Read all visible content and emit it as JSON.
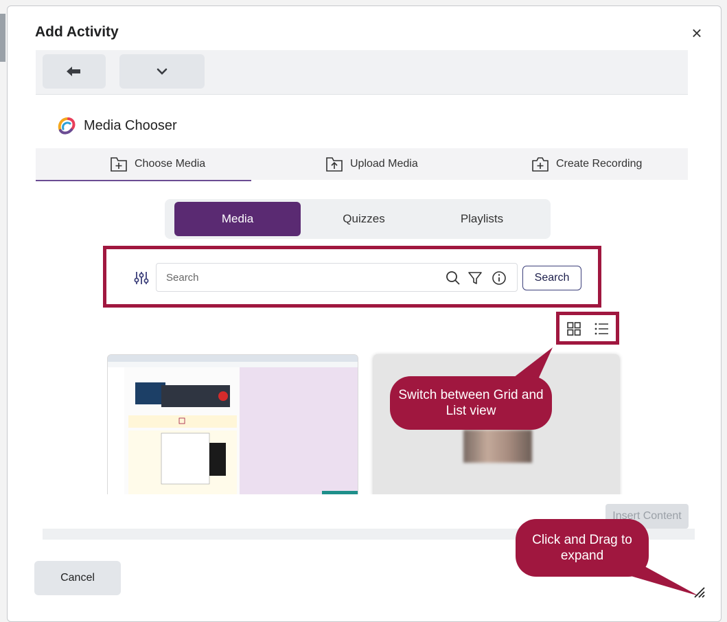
{
  "dialog": {
    "title": "Add Activity",
    "close_glyph": "×",
    "cancel_label": "Cancel",
    "insert_label": "Insert Content"
  },
  "toolbar": {
    "back_icon": "arrow-left-icon",
    "menu_icon": "chevron-down-icon"
  },
  "media_chooser": {
    "title": "Media Chooser",
    "nav": [
      {
        "label": "Choose Media",
        "icon": "folder-plus-icon"
      },
      {
        "label": "Upload Media",
        "icon": "folder-upload-icon"
      },
      {
        "label": "Create Recording",
        "icon": "camera-plus-icon"
      }
    ],
    "tabs": [
      "Media",
      "Quizzes",
      "Playlists"
    ],
    "active_tab": "Media",
    "search": {
      "placeholder": "Search",
      "button_label": "Search"
    },
    "view_modes": [
      "grid-view-icon",
      "list-view-icon"
    ]
  },
  "callouts": {
    "view_switch": "Switch between Grid and List view",
    "resize": "Click and Drag to expand"
  },
  "colors": {
    "accent": "#5a2a72",
    "highlight": "#a0173f",
    "nav_underline": "#6a4c93"
  }
}
